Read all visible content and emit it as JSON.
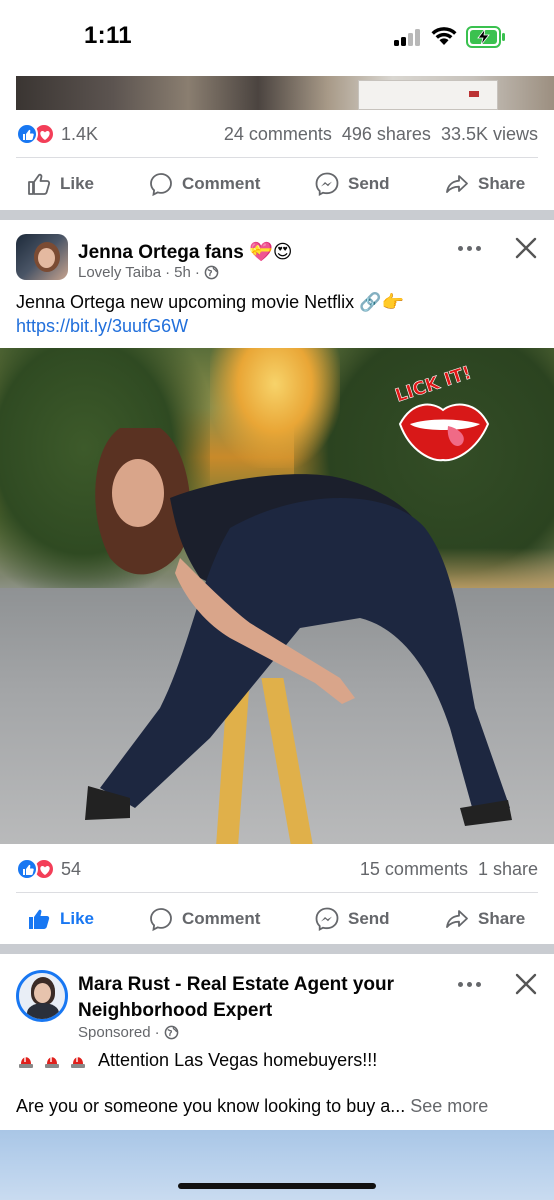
{
  "status_bar": {
    "time": "1:11"
  },
  "post_prev": {
    "reaction_count": "1.4K",
    "comments": "24 comments",
    "shares": "496 shares",
    "views": "33.5K views"
  },
  "actions": {
    "like": "Like",
    "comment": "Comment",
    "send": "Send",
    "share": "Share"
  },
  "post1": {
    "title": "Jenna Ortega fans 💝😍",
    "author": "Lovely Taiba",
    "time": "5h",
    "text": "Jenna Ortega new upcoming movie Netflix 🔗👉",
    "link": "https://bit.ly/3uufG6W",
    "sticker_text": "LICK IT!",
    "reaction_count": "54",
    "comments": "15 comments",
    "shares": "1 share",
    "liked": true
  },
  "post2": {
    "title_line1": "Mara Rust - Real Estate Agent your",
    "title_line2": "Neighborhood Expert",
    "sponsored": "Sponsored",
    "headline": "Attention Las Vegas homebuyers!!!",
    "body": "Are you or someone you know looking to buy a...",
    "see_more": "See more"
  },
  "colors": {
    "brand_blue": "#1877f2",
    "love_red": "#f33e58",
    "muted": "#65676b"
  }
}
